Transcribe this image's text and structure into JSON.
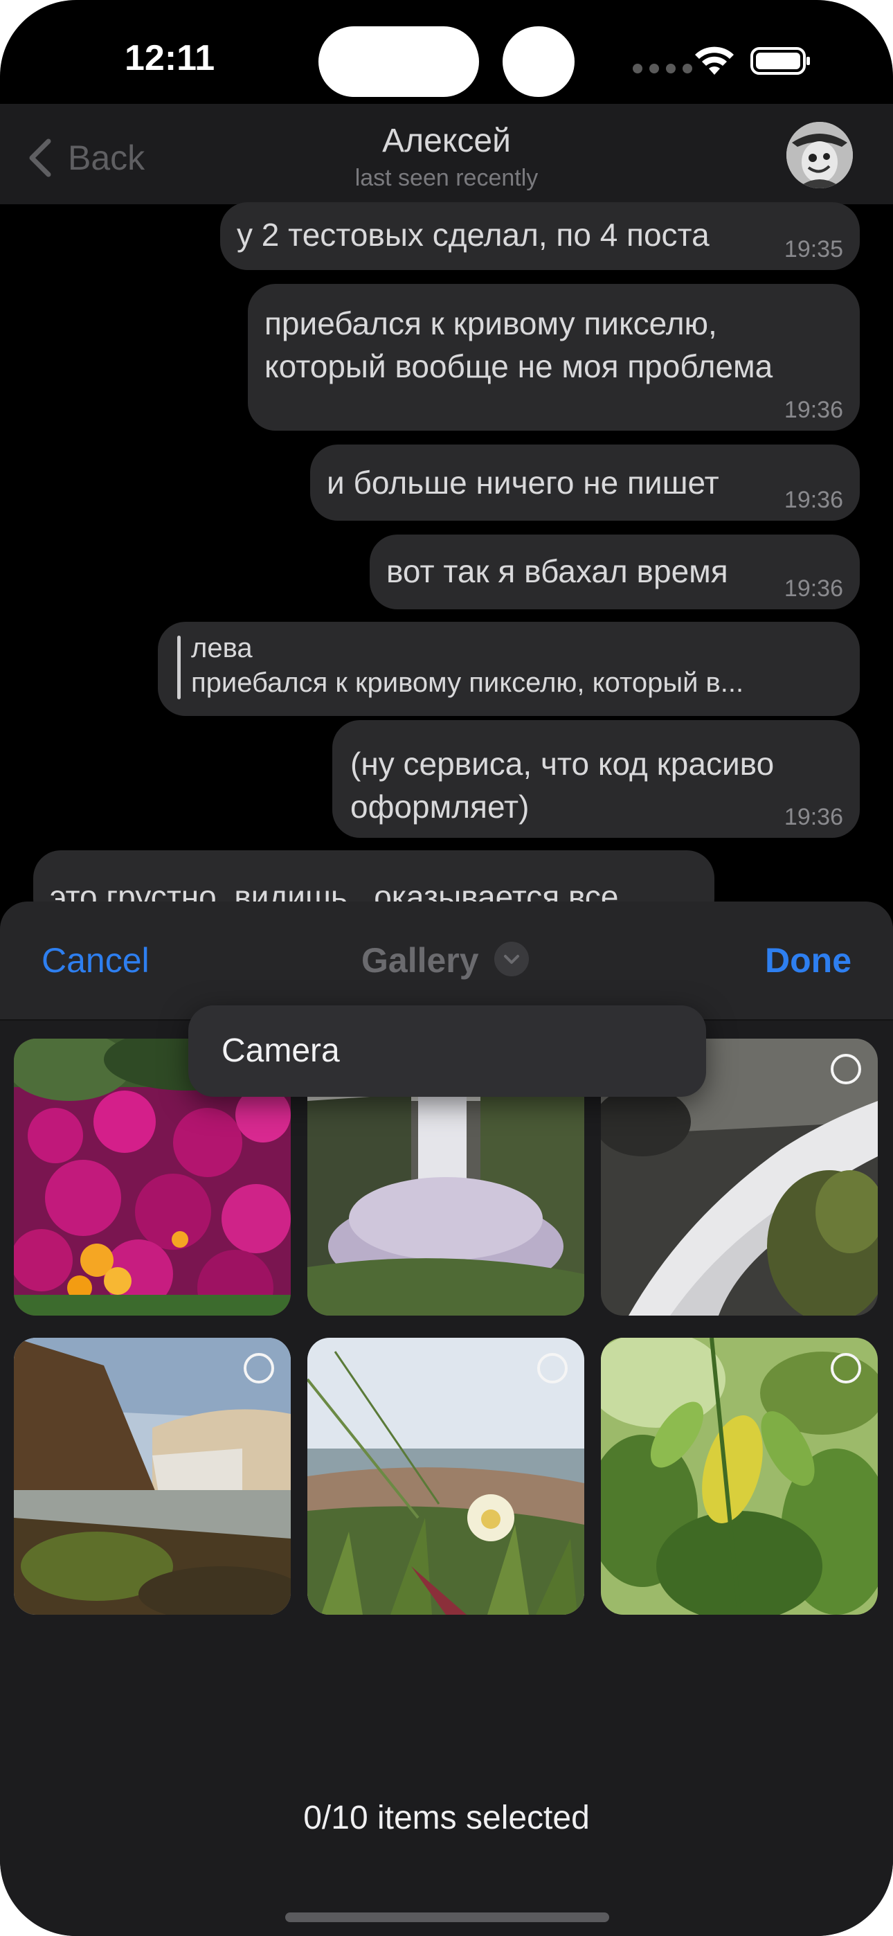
{
  "status_bar": {
    "time": "12:11"
  },
  "navbar": {
    "back_label": "Back",
    "title": "Алексей",
    "subtitle": "last seen recently"
  },
  "messages": [
    {
      "text": "у 2 тестовых сделал, по 4 поста",
      "time": "19:35"
    },
    {
      "text": "приебался к кривому пикселю,\nкоторый вообще не моя проблема",
      "time": "19:36"
    },
    {
      "text": "и больше ничего не пишет",
      "time": "19:36"
    },
    {
      "text": "вот так я вбахал время",
      "time": "19:36"
    },
    {
      "reply_name": "лева",
      "reply_text": "приебался к кривому пикселю, который в..."
    },
    {
      "text": "(ну сервиса, что код красиво\nоформляет)",
      "time": "19:36"
    },
    {
      "text": "это грустно. видишь . оказывается все"
    }
  ],
  "sheet": {
    "cancel_label": "Cancel",
    "title": "Gallery",
    "done_label": "Done",
    "dropdown_option": "Camera",
    "selected_count": "0/10 items selected"
  },
  "photos": [
    {
      "name": "pink flowers"
    },
    {
      "name": "waterfall in mist"
    },
    {
      "name": "waterfall over rocks"
    },
    {
      "name": "waterfall canyon"
    },
    {
      "name": "coastal flower"
    },
    {
      "name": "green leaves"
    }
  ],
  "colors": {
    "accent": "#2e7ff0",
    "bubble": "#2a2a2c",
    "sheet": "#1c1c1e"
  }
}
